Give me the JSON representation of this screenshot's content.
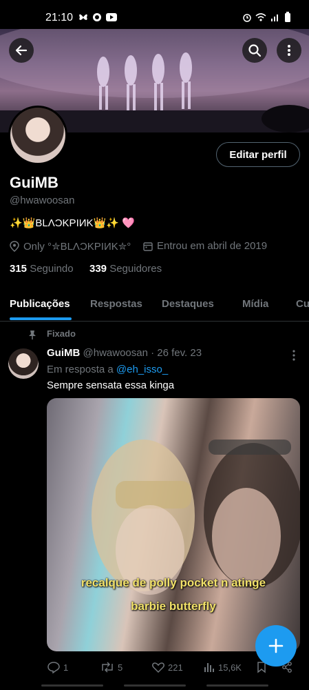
{
  "status": {
    "time": "21:10"
  },
  "profile": {
    "edit_label": "Editar perfil",
    "name": "GuiMB",
    "handle": "@hwawoosan",
    "bio": "✨👑BLΛϽKPIИK👑✨ 🩷",
    "location": "Only °✮BLΛϽKPIИK✮°",
    "joined": "Entrou em abril de 2019",
    "following_count": "315",
    "following_label": "Seguindo",
    "followers_count": "339",
    "followers_label": "Seguidores"
  },
  "tabs": [
    "Publicações",
    "Respostas",
    "Destaques",
    "Mídia",
    "Cu"
  ],
  "post": {
    "pinned_label": "Fixado",
    "author": "GuiMB",
    "handle_date": "@hwawoosan · 26 fev. 23",
    "reply_prefix": "Em resposta a",
    "reply_to": "@eh_isso_",
    "text": "Sempre sensata essa kinga",
    "caption_line1": "recalque de polly pocket n atinge",
    "caption_line2": "barbie butterfly",
    "replies": "1",
    "reposts": "5",
    "likes": "221",
    "views": "15,6K"
  },
  "colors": {
    "accent": "#1d9bf0",
    "muted": "#71767b",
    "background": "#000000"
  }
}
